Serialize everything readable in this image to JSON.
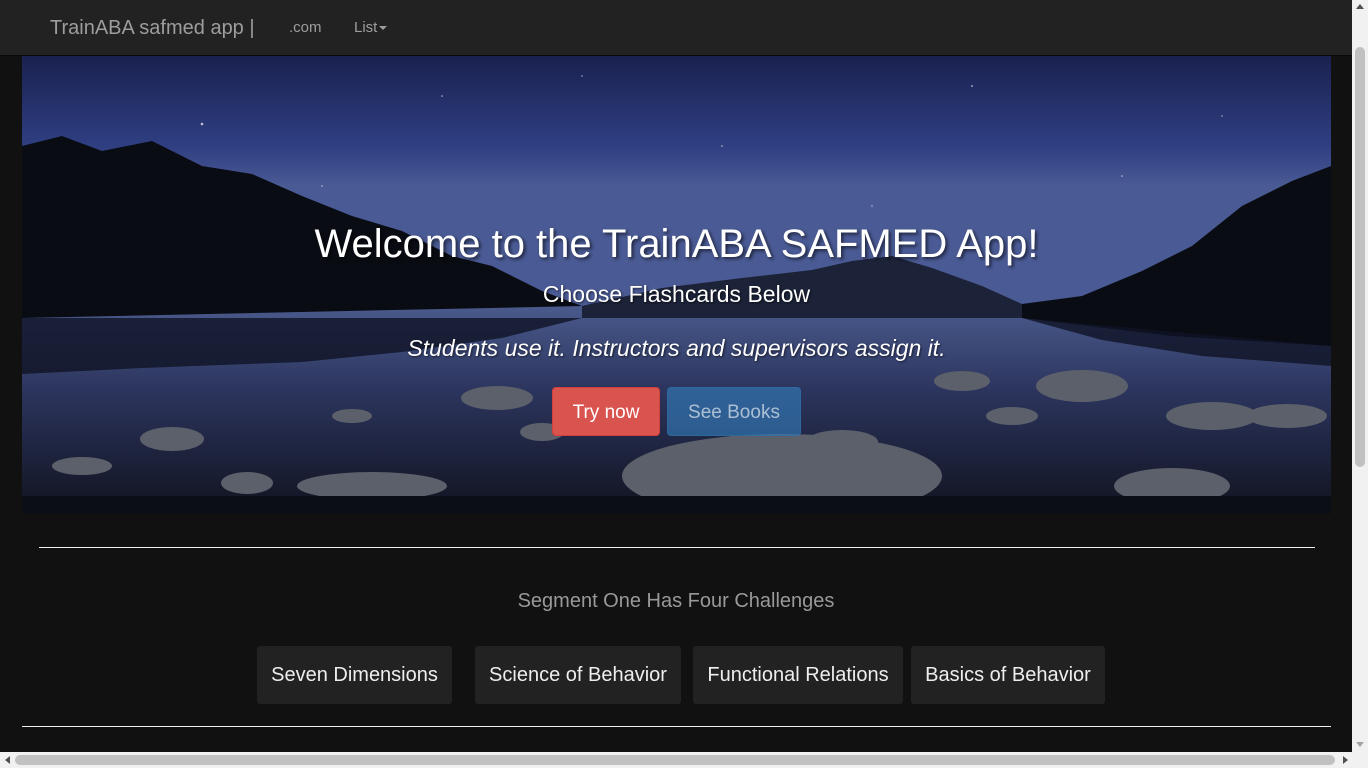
{
  "navbar": {
    "brand": "TrainABA safmed app |",
    "links": [
      ".com",
      "List"
    ]
  },
  "hero": {
    "title": "Welcome to the TrainABA SAFMED App!",
    "subtitle": "Choose Flashcards Below",
    "tagline": "Students use it. Instructors and supervisors assign it.",
    "try_button": "Try now",
    "books_button": "See Books"
  },
  "segment": {
    "heading": "Segment One Has Four Challenges",
    "challenges": [
      "Seven Dimensions",
      "Science of Behavior",
      "Functional Relations",
      "Basics of Behavior"
    ]
  },
  "colors": {
    "navbar_bg": "#222222",
    "page_bg": "#111111",
    "danger": "#d9534f",
    "primary": "#337ab7"
  },
  "icons": {
    "dropdown": "caret-down-icon"
  }
}
